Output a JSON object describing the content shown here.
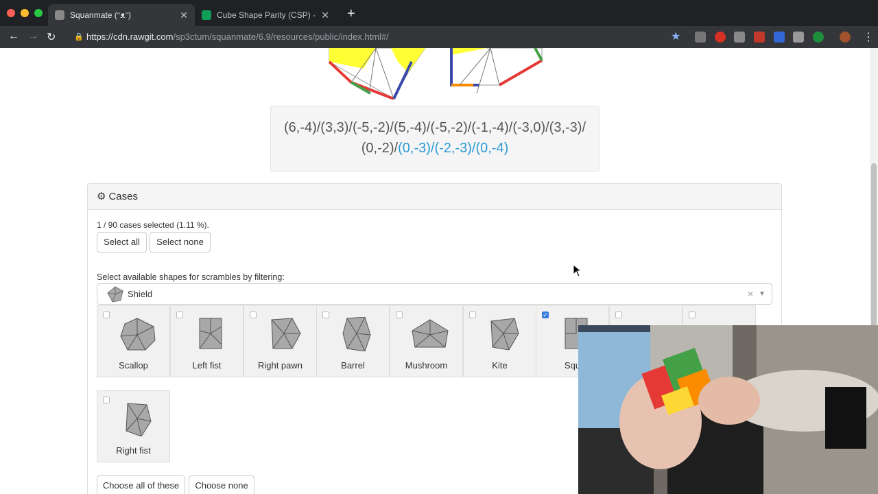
{
  "browser": {
    "tabs": [
      {
        "title": "Squanmate (ᵔᴥᵔ)",
        "active": true
      },
      {
        "title": "Cube Shape Parity (CSP) - Goo",
        "active": false
      }
    ],
    "url_host": "https://cdn.rawgit.com",
    "url_path": "/sp3ctum/squanmate/6.9/resources/public/index.html#/"
  },
  "scramble": {
    "line1": "(6,-4)/(3,3)/(-5,-2)/(5,-4)/(-5,-2)/(-1,-4)/(-3,0)/(3,-3)/",
    "line2_plain": "(0,-2)/",
    "line2_highlight": "(0,-3)/(-2,-3)/(0,-4)"
  },
  "cases_panel": {
    "title": "Cases",
    "selection_text": "1 / 90 cases selected (1.11 %).",
    "select_all": "Select all",
    "select_none": "Select none",
    "filter_label": "Select available shapes for scrambles by filtering:",
    "filter_value": "Shield",
    "clear_symbol": "×",
    "shapes": [
      {
        "name": "Scallop",
        "checked": false
      },
      {
        "name": "Left fist",
        "checked": false
      },
      {
        "name": "Right pawn",
        "checked": false
      },
      {
        "name": "Barrel",
        "checked": false
      },
      {
        "name": "Mushroom",
        "checked": false
      },
      {
        "name": "Kite",
        "checked": false
      },
      {
        "name": "Squ",
        "checked": true
      },
      {
        "name": "",
        "checked": false
      },
      {
        "name": "",
        "checked": false
      },
      {
        "name": "Right fist",
        "checked": false
      }
    ],
    "choose_all": "Choose all of these",
    "choose_none": "Choose none"
  },
  "colors": {
    "accent": "#2b9bd6",
    "checkbox": "#3b7ddd",
    "chrome_dark": "#202124"
  }
}
